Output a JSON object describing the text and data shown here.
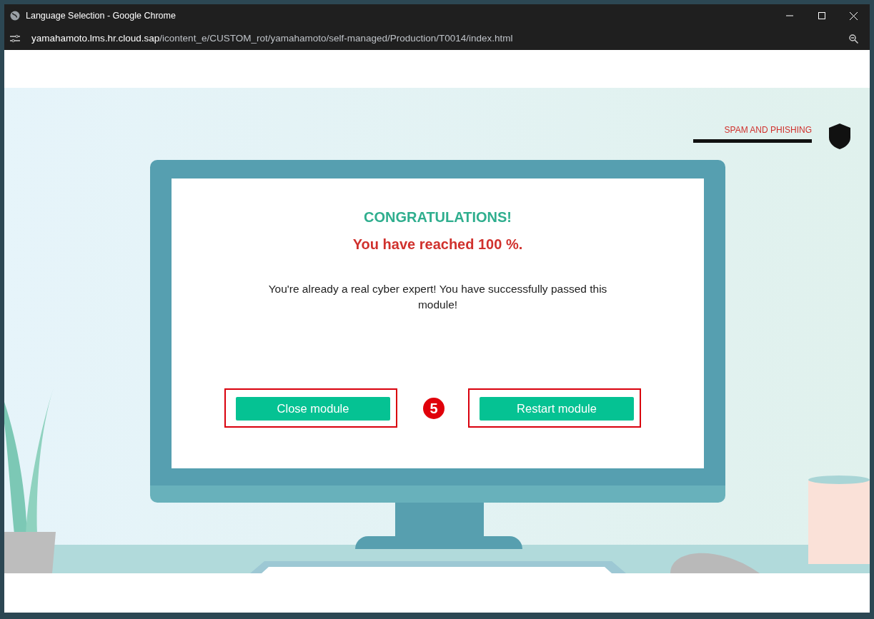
{
  "window": {
    "title": "Language Selection - Google Chrome"
  },
  "address_bar": {
    "host": "yamahamoto.lms.hr.cloud.sap",
    "path": "/icontent_e/CUSTOM_rot/yamahamoto/self-managed/Production/T0014/index.html"
  },
  "header": {
    "label": "SPAM AND PHISHING"
  },
  "screen": {
    "title": "CONGRATULATIONS!",
    "subtitle": "You have reached 100 %.",
    "message": "You're already a real cyber expert! You have successfully passed this module!"
  },
  "buttons": [
    {
      "label": "Close module",
      "annotated": true
    },
    {
      "label": "Restart module",
      "annotated": true
    }
  ],
  "annotation": {
    "number": "5"
  }
}
